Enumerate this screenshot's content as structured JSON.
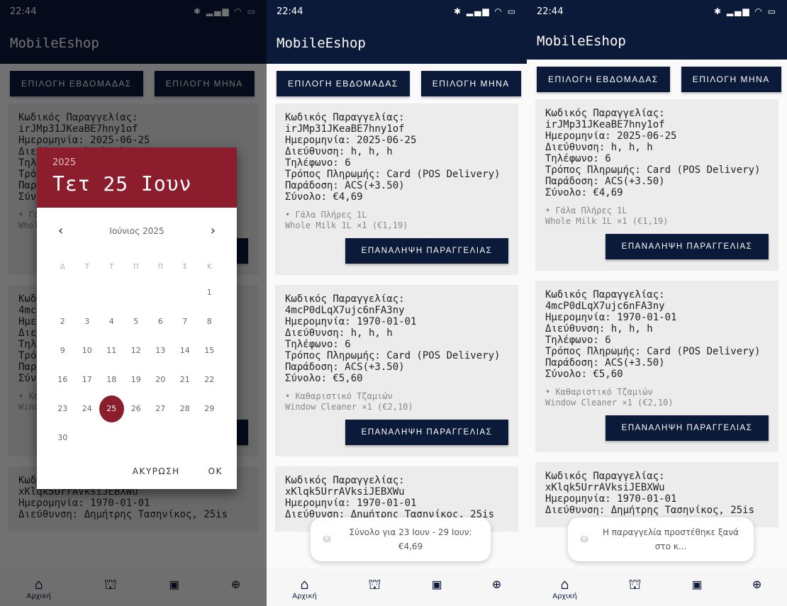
{
  "status": {
    "time": "22:44",
    "icons": "✱ ▂▄▆ ◠ ▭"
  },
  "app": {
    "title": "MobileEshop"
  },
  "buttons": {
    "week": "ΕΠΙΛΟΓΗ ΕΒΔΟΜΑΔΑΣ",
    "month": "ΕΠΙΛΟΓΗ ΜΗΝΑ",
    "reorder": "ΕΠΑΝΑΛΗΨΗ ΠΑΡΑΓΓΕΛΙΑΣ"
  },
  "orders": [
    {
      "code_label": "Κωδικός Παραγγελίας:",
      "code": "irJMp31JKeaBE7hny1of",
      "date": "Ημερομηνία: 2025-06-25",
      "address": "Διεύθυνση: h, h, h",
      "phone": "Τηλέφωνο: 6",
      "payment": "Τρόπος Πληρωμής: Card (POS Delivery)",
      "delivery": "Παράδοση: ACS(+3.50)",
      "total": "Σύνολο: €4,69",
      "item_gr": "• Γάλα Πλήρες 1L",
      "item_en": "Whole Milk 1L ×1 (€1,19)"
    },
    {
      "code_label": "Κωδικός Παραγγελίας:",
      "code": "4mcP0dLqX7ujc6nFA3ny",
      "date": "Ημερομηνία: 1970-01-01",
      "address": "Διεύθυνση: h, h, h",
      "phone": "Τηλέφωνο: 6",
      "payment": "Τρόπος Πληρωμής: Card (POS Delivery)",
      "delivery": "Παράδοση: ACS(+3.50)",
      "total": "Σύνολο: €5,60",
      "item_gr": "• Καθαριστικό Τζαμιών",
      "item_en": "Window Cleaner ×1 (€2,10)"
    },
    {
      "code_label": "Κωδικός Παραγγελίας:",
      "code": "xKlqk5UrrAVksiJEBXWu",
      "date": "Ημερομηνία: 1970-01-01",
      "address": "Διεύθυνση: Δημήτρης Τασηνίκος, 25is"
    }
  ],
  "picker": {
    "year": "2025",
    "selected_date": "Τετ 25 Ιουν",
    "month_label": "Ιούνιος 2025",
    "weekdays": [
      "Δ",
      "Τ",
      "Τ",
      "Π",
      "Π",
      "Σ",
      "Κ"
    ],
    "days": [
      "",
      "",
      "",
      "",
      "",
      "",
      "1",
      "2",
      "3",
      "4",
      "5",
      "6",
      "7",
      "8",
      "9",
      "10",
      "11",
      "12",
      "13",
      "14",
      "15",
      "16",
      "17",
      "18",
      "19",
      "20",
      "21",
      "22",
      "23",
      "24",
      "25",
      "26",
      "27",
      "28",
      "29",
      "30"
    ],
    "selected_day": "25",
    "cancel": "ΑΚΥΡΩΣΗ",
    "ok": "OK"
  },
  "toasts": {
    "week_total": "Σύνολο για 23 Ιουν - 29 Ιουν: €4,69",
    "reorder_added": "Η παραγγελία προστέθηκε ξανά στο κ..."
  },
  "nav": {
    "home_label": "Αρχική",
    "icons": {
      "home": "⌂",
      "shop": "⛫",
      "profile": "▣",
      "language": "⊕"
    }
  }
}
